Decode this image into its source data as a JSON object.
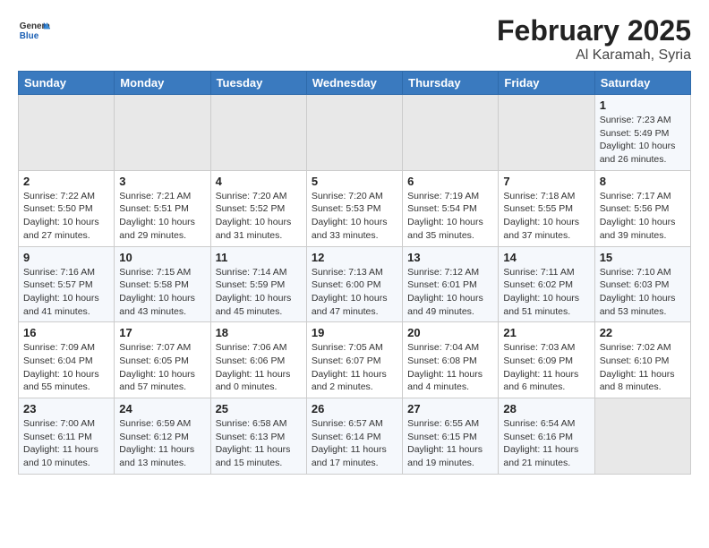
{
  "header": {
    "logo_general": "General",
    "logo_blue": "Blue",
    "title": "February 2025",
    "subtitle": "Al Karamah, Syria"
  },
  "weekdays": [
    "Sunday",
    "Monday",
    "Tuesday",
    "Wednesday",
    "Thursday",
    "Friday",
    "Saturday"
  ],
  "weeks": [
    [
      {
        "day": "",
        "info": ""
      },
      {
        "day": "",
        "info": ""
      },
      {
        "day": "",
        "info": ""
      },
      {
        "day": "",
        "info": ""
      },
      {
        "day": "",
        "info": ""
      },
      {
        "day": "",
        "info": ""
      },
      {
        "day": "1",
        "info": "Sunrise: 7:23 AM\nSunset: 5:49 PM\nDaylight: 10 hours and 26 minutes."
      }
    ],
    [
      {
        "day": "2",
        "info": "Sunrise: 7:22 AM\nSunset: 5:50 PM\nDaylight: 10 hours and 27 minutes."
      },
      {
        "day": "3",
        "info": "Sunrise: 7:21 AM\nSunset: 5:51 PM\nDaylight: 10 hours and 29 minutes."
      },
      {
        "day": "4",
        "info": "Sunrise: 7:20 AM\nSunset: 5:52 PM\nDaylight: 10 hours and 31 minutes."
      },
      {
        "day": "5",
        "info": "Sunrise: 7:20 AM\nSunset: 5:53 PM\nDaylight: 10 hours and 33 minutes."
      },
      {
        "day": "6",
        "info": "Sunrise: 7:19 AM\nSunset: 5:54 PM\nDaylight: 10 hours and 35 minutes."
      },
      {
        "day": "7",
        "info": "Sunrise: 7:18 AM\nSunset: 5:55 PM\nDaylight: 10 hours and 37 minutes."
      },
      {
        "day": "8",
        "info": "Sunrise: 7:17 AM\nSunset: 5:56 PM\nDaylight: 10 hours and 39 minutes."
      }
    ],
    [
      {
        "day": "9",
        "info": "Sunrise: 7:16 AM\nSunset: 5:57 PM\nDaylight: 10 hours and 41 minutes."
      },
      {
        "day": "10",
        "info": "Sunrise: 7:15 AM\nSunset: 5:58 PM\nDaylight: 10 hours and 43 minutes."
      },
      {
        "day": "11",
        "info": "Sunrise: 7:14 AM\nSunset: 5:59 PM\nDaylight: 10 hours and 45 minutes."
      },
      {
        "day": "12",
        "info": "Sunrise: 7:13 AM\nSunset: 6:00 PM\nDaylight: 10 hours and 47 minutes."
      },
      {
        "day": "13",
        "info": "Sunrise: 7:12 AM\nSunset: 6:01 PM\nDaylight: 10 hours and 49 minutes."
      },
      {
        "day": "14",
        "info": "Sunrise: 7:11 AM\nSunset: 6:02 PM\nDaylight: 10 hours and 51 minutes."
      },
      {
        "day": "15",
        "info": "Sunrise: 7:10 AM\nSunset: 6:03 PM\nDaylight: 10 hours and 53 minutes."
      }
    ],
    [
      {
        "day": "16",
        "info": "Sunrise: 7:09 AM\nSunset: 6:04 PM\nDaylight: 10 hours and 55 minutes."
      },
      {
        "day": "17",
        "info": "Sunrise: 7:07 AM\nSunset: 6:05 PM\nDaylight: 10 hours and 57 minutes."
      },
      {
        "day": "18",
        "info": "Sunrise: 7:06 AM\nSunset: 6:06 PM\nDaylight: 11 hours and 0 minutes."
      },
      {
        "day": "19",
        "info": "Sunrise: 7:05 AM\nSunset: 6:07 PM\nDaylight: 11 hours and 2 minutes."
      },
      {
        "day": "20",
        "info": "Sunrise: 7:04 AM\nSunset: 6:08 PM\nDaylight: 11 hours and 4 minutes."
      },
      {
        "day": "21",
        "info": "Sunrise: 7:03 AM\nSunset: 6:09 PM\nDaylight: 11 hours and 6 minutes."
      },
      {
        "day": "22",
        "info": "Sunrise: 7:02 AM\nSunset: 6:10 PM\nDaylight: 11 hours and 8 minutes."
      }
    ],
    [
      {
        "day": "23",
        "info": "Sunrise: 7:00 AM\nSunset: 6:11 PM\nDaylight: 11 hours and 10 minutes."
      },
      {
        "day": "24",
        "info": "Sunrise: 6:59 AM\nSunset: 6:12 PM\nDaylight: 11 hours and 13 minutes."
      },
      {
        "day": "25",
        "info": "Sunrise: 6:58 AM\nSunset: 6:13 PM\nDaylight: 11 hours and 15 minutes."
      },
      {
        "day": "26",
        "info": "Sunrise: 6:57 AM\nSunset: 6:14 PM\nDaylight: 11 hours and 17 minutes."
      },
      {
        "day": "27",
        "info": "Sunrise: 6:55 AM\nSunset: 6:15 PM\nDaylight: 11 hours and 19 minutes."
      },
      {
        "day": "28",
        "info": "Sunrise: 6:54 AM\nSunset: 6:16 PM\nDaylight: 11 hours and 21 minutes."
      },
      {
        "day": "",
        "info": ""
      }
    ]
  ]
}
